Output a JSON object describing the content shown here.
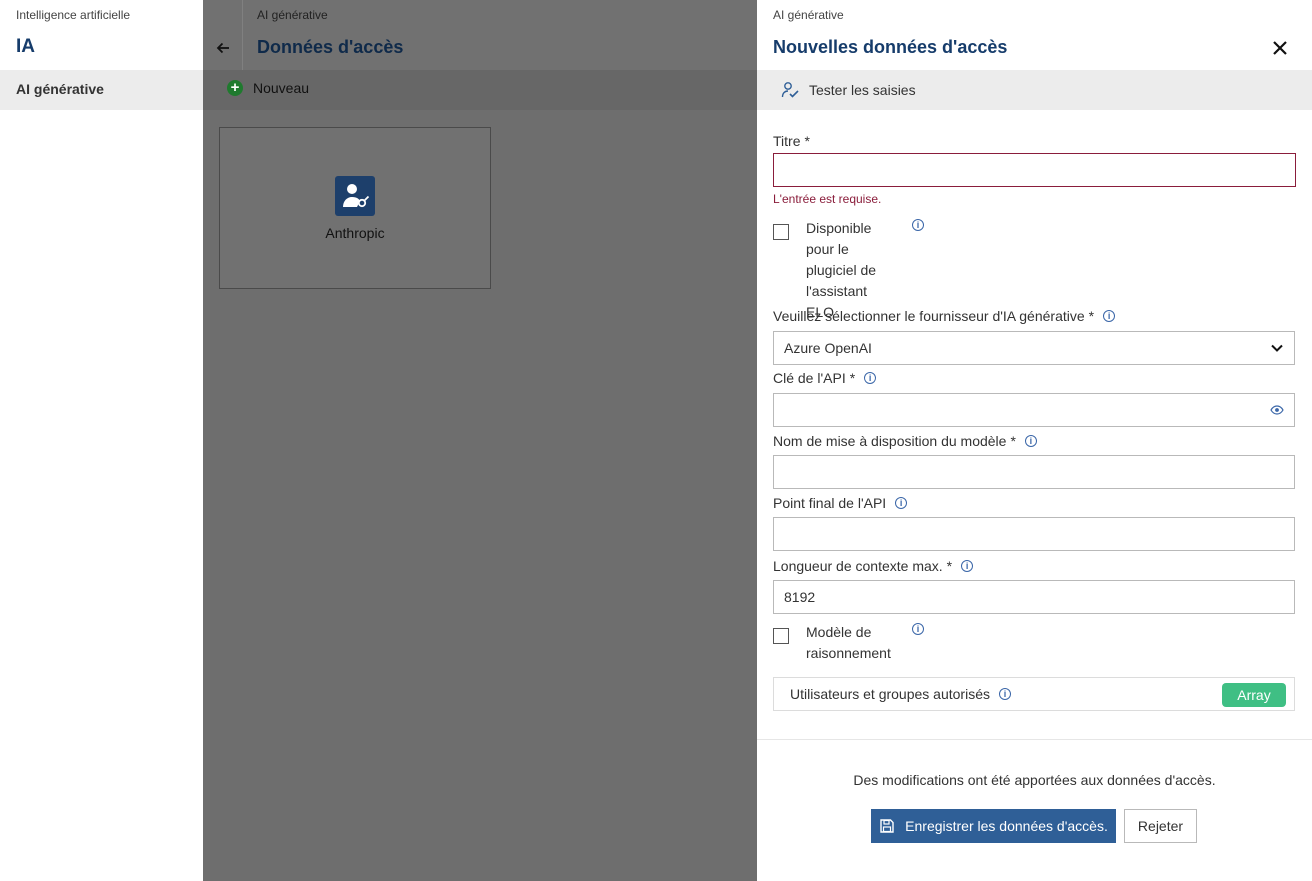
{
  "left": {
    "breadcrumb": "Intelligence artificielle",
    "title": "IA",
    "nav_items": [
      {
        "label": "AI générative"
      }
    ]
  },
  "middle": {
    "breadcrumb": "AI générative",
    "title": "Données d'accès",
    "toolbar": {
      "new_label": "Nouveau"
    },
    "tiles": [
      {
        "label": "Anthropic",
        "icon": "person-key-icon"
      }
    ]
  },
  "panel": {
    "breadcrumb": "AI générative",
    "title": "Nouvelles données d'accès",
    "toolbar": {
      "test_label": "Tester les saisies"
    },
    "form": {
      "title_field": {
        "label": "Titre",
        "required": "*",
        "value": "",
        "error": "L'entrée est requise."
      },
      "plugin_checkbox": {
        "label": "Disponible pour le plugiciel de l'assistant ELO",
        "checked": false
      },
      "provider": {
        "label": "Veuillez sélectionner le fournisseur d'IA générative",
        "required": "*",
        "value": "Azure OpenAI"
      },
      "api_key": {
        "label": "Clé de l'API",
        "required": "*",
        "value": ""
      },
      "deployment_name": {
        "label": "Nom de mise à disposition du modèle",
        "required": "*",
        "value": ""
      },
      "endpoint": {
        "label": "Point final de l'API",
        "value": ""
      },
      "context_length": {
        "label": "Longueur de contexte max.",
        "required": "*",
        "value": "8192"
      },
      "reasoning_checkbox": {
        "label": "Modèle de raisonnement",
        "checked": false
      },
      "users": {
        "label": "Utilisateurs et groupes autorisés",
        "badge": "Array"
      }
    },
    "footer": {
      "notice": "Des modifications ont été apportées aux données d'accès.",
      "save_label": "Enregistrer les données d'accès.",
      "reject_label": "Rejeter"
    }
  },
  "colors": {
    "accent": "#163c6b",
    "primary_button": "#2f5f97",
    "error": "#8a1d3b",
    "badge": "#3fbf84",
    "overlay": "#6e6e6e"
  }
}
